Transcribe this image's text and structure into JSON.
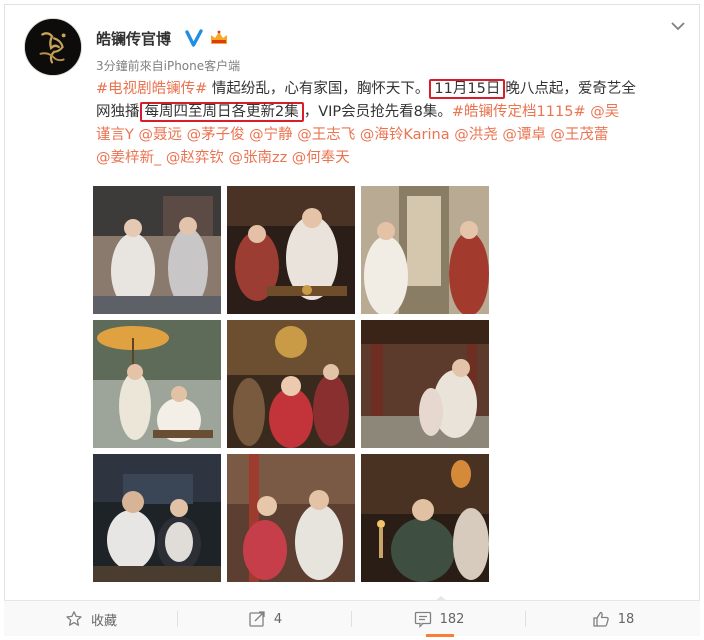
{
  "header": {
    "username": "皓镧传官博",
    "meta": "3分鐘前來自iPhone客户端",
    "verified_icon": "verified-badge-icon",
    "member_icon": "member-crown-icon"
  },
  "post": {
    "line1": {
      "tag": "#电视剧皓镧传#",
      "text1": " 情起纷乱，心有家国，胸怀天下。",
      "date_boxed": "11月15日",
      "text2": "晚八点起，爱奇艺全"
    },
    "line2": {
      "text1": "网独播",
      "schedule_boxed": "每周四至周日各更新2集",
      "text2": "，VIP会员抢先看8集。",
      "tag": "#皓镧传定档1115#",
      "at1": " @吴"
    },
    "line3": {
      "mentions": "谨言Y @聂远 @茅子俊 @宁静 @王志飞 @海铃Karina @洪尧 @谭卓 @王茂蕾"
    },
    "line4": {
      "mentions": "@姜梓新_ @赵弈钦 @张南zz @何奉天"
    }
  },
  "photos": [
    {
      "name": "photo-1",
      "desc": "courtyard-scene"
    },
    {
      "name": "photo-2",
      "desc": "banquet-scene"
    },
    {
      "name": "photo-3",
      "desc": "palace-scene"
    },
    {
      "name": "photo-4",
      "desc": "umbrella-scene"
    },
    {
      "name": "photo-5",
      "desc": "court-scene"
    },
    {
      "name": "photo-6",
      "desc": "corridor-scene"
    },
    {
      "name": "photo-7",
      "desc": "throne-scene"
    },
    {
      "name": "photo-8",
      "desc": "lantern-scene"
    },
    {
      "name": "photo-9",
      "desc": "candle-scene"
    }
  ],
  "actions": {
    "favorite": "收藏",
    "repost": "4",
    "comment": "182",
    "like": "18"
  },
  "colors": {
    "link": "#eb7350",
    "highlight_box": "#d81e2a",
    "verified": "#1e8fe1",
    "member": "#f7a825"
  }
}
